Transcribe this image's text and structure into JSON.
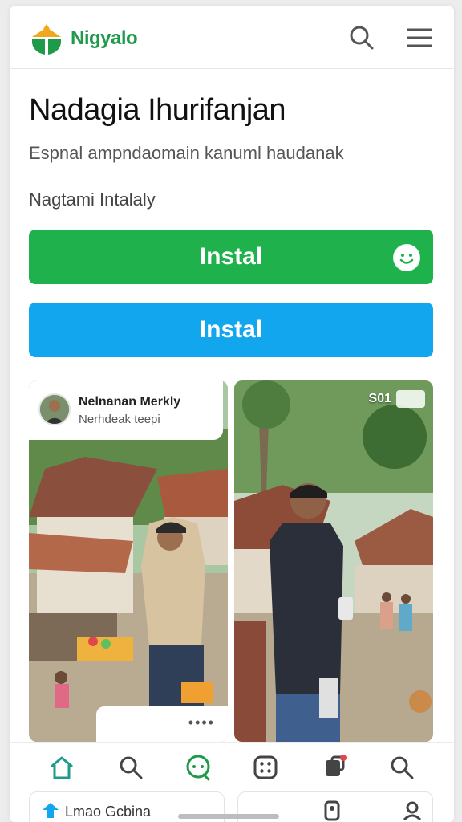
{
  "header": {
    "brand": "Nigyalo",
    "logo_icon": "sun-shield-logo-icon",
    "search_icon": "search-icon",
    "menu_icon": "hamburger-menu-icon",
    "brand_color": "#1e9a4a"
  },
  "main": {
    "title": "Nadagia Ihurifanjan",
    "subtitle": "Espnal ampndaomain kanuml haudanak",
    "meta": "Nagtami Intalaly",
    "install_primary_label": "Instal",
    "install_secondary_label": "Instal",
    "primary_color": "#1fb24c",
    "secondary_color": "#12a6ee",
    "primary_button_icon": "smiley-icon"
  },
  "cards": [
    {
      "profile_name": "Nelnanan Merkly",
      "profile_sub": "Nerhdeak teepi",
      "more_label": "••••"
    },
    {
      "overlay_text": "S01"
    }
  ],
  "bottom_nav": [
    {
      "icon": "home-icon"
    },
    {
      "icon": "search-icon"
    },
    {
      "icon": "chat-bubble-icon"
    },
    {
      "icon": "grid-apps-icon"
    },
    {
      "icon": "notification-bell-icon"
    },
    {
      "icon": "search-icon"
    }
  ],
  "peek_cards": [
    {
      "label": "Lmao Gcbina",
      "icon": "house-icon"
    },
    {
      "label": "",
      "icon": "device-icon"
    }
  ]
}
